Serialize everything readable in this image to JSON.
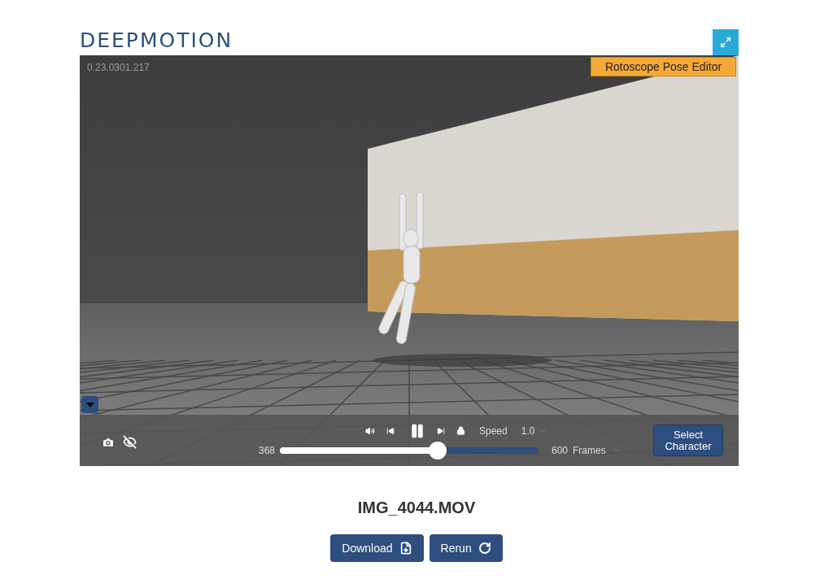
{
  "logo": "DEEPMOTION",
  "version": "0.23.0301.217",
  "editor_button": "Rotoscope Pose Editor",
  "player": {
    "playing": true,
    "speed_label": "Speed",
    "speed": "1.0",
    "current_frame": "368",
    "level": 0.61,
    "total_frames": "600",
    "frames_unit": "Frames",
    "select_button": "Select Character"
  },
  "file_name": "IMG_4044.MOV",
  "buttons": [
    {
      "label": "Download",
      "kind": "download"
    },
    {
      "label": "Rerun",
      "kind": "rerun"
    }
  ]
}
